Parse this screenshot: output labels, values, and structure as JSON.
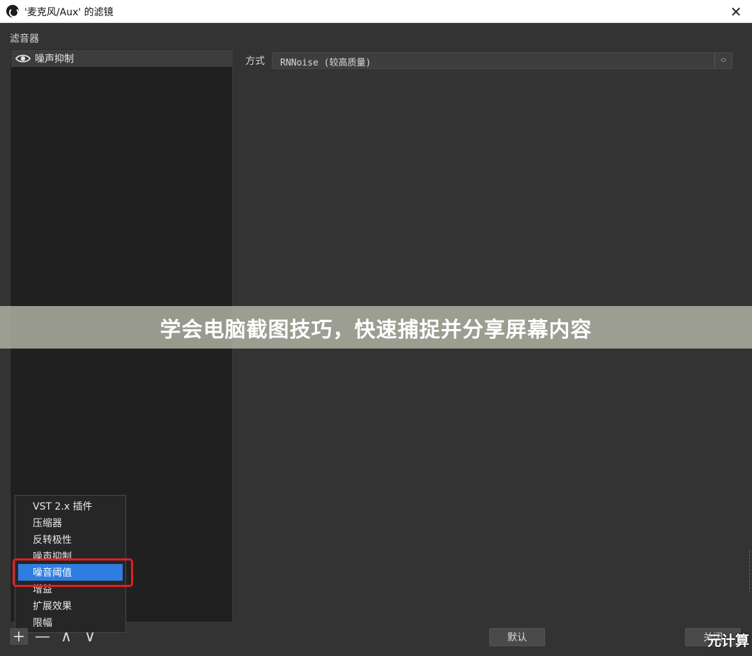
{
  "titlebar": {
    "title": "'麦克风/Aux' 的滤镜",
    "close_glyph": "✕"
  },
  "filters_panel": {
    "label": "滤音器",
    "items": [
      {
        "label": "噪声抑制",
        "icon": "eye-icon"
      }
    ]
  },
  "settings": {
    "method_label": "方式",
    "method_value": "RNNoise (较高质量)"
  },
  "banner": {
    "text": "学会电脑截图技巧，快速捕捉并分享屏幕内容"
  },
  "add_menu": {
    "items": [
      {
        "label": "VST 2.x 插件"
      },
      {
        "label": "压缩器"
      },
      {
        "label": "反转极性"
      },
      {
        "label": "噪声抑制"
      },
      {
        "label": "噪音阈值",
        "selected": true
      },
      {
        "label": "增益"
      },
      {
        "label": "扩展效果"
      },
      {
        "label": "限幅"
      }
    ]
  },
  "toolbar": {
    "add_glyph": "+",
    "remove_glyph": "—",
    "up_glyph": "∧",
    "down_glyph": "∨"
  },
  "buttons": {
    "default_label": "默认",
    "close_label": "关闭"
  },
  "watermark": {
    "text": "元计算"
  },
  "colors": {
    "accent": "#2f7de0",
    "highlight_border": "#e02020",
    "window_bg": "#333333",
    "list_bg": "#202020"
  }
}
